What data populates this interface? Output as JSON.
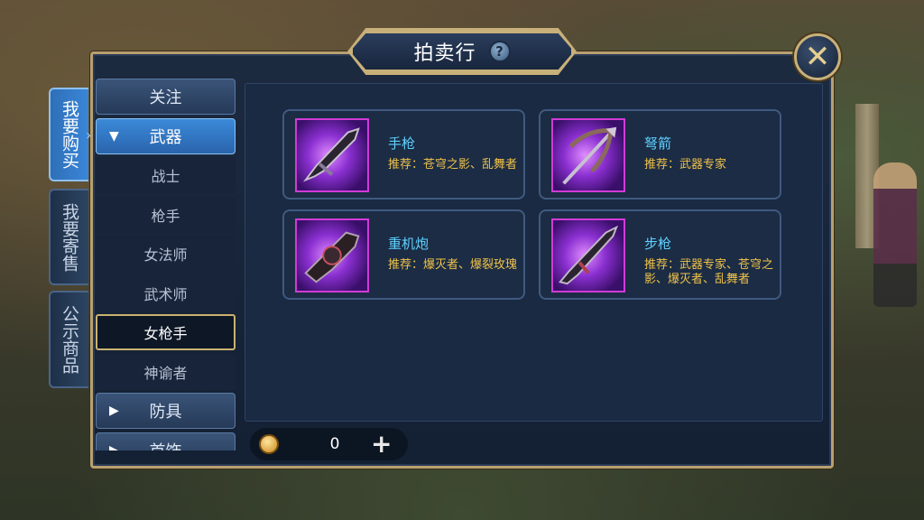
{
  "title": "拍卖行",
  "help_symbol": "?",
  "close_symbol": "✕",
  "left_tabs": [
    {
      "label": "我要购买",
      "active": true
    },
    {
      "label": "我要寄售",
      "active": false
    },
    {
      "label": "公示商品",
      "active": false
    }
  ],
  "categories": {
    "follow": "关注",
    "weapons": "武器",
    "weapon_subs": [
      "战士",
      "枪手",
      "女法师",
      "武术师",
      "女枪手",
      "神谕者"
    ],
    "selected_sub": "女枪手",
    "armor": "防具",
    "accessories": "首饰"
  },
  "items": [
    {
      "name": "手枪",
      "recommend": "推荐：苍穹之影、乱舞者"
    },
    {
      "name": "弩箭",
      "recommend": "推荐：武器专家"
    },
    {
      "name": "重机炮",
      "recommend": "推荐：爆灭者、爆裂玫瑰"
    },
    {
      "name": "步枪",
      "recommend": "推荐：武器专家、苍穹之影、爆灭者、乱舞者"
    }
  ],
  "currency": {
    "value": "0",
    "plus": "+"
  },
  "colors": {
    "frame_gold": "#c8b07a",
    "active_blue": "#3a86d8",
    "rare_purple": "#d13bd6",
    "name_cyan": "#5fd0ff",
    "recommend_yellow": "#f0c24a"
  }
}
